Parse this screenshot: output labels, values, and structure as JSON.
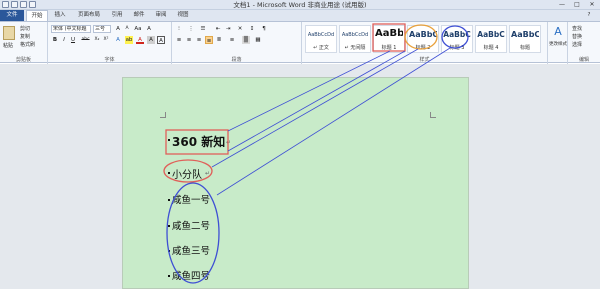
{
  "window": {
    "title": "文档1 - Microsoft Word 非商业用途 (试用版)",
    "controls": [
      "—",
      "□",
      "✕"
    ]
  },
  "tabs": [
    {
      "label": "文件"
    },
    {
      "label": "开始"
    },
    {
      "label": "插入"
    },
    {
      "label": "页面布局"
    },
    {
      "label": "引用"
    },
    {
      "label": "邮件"
    },
    {
      "label": "审阅"
    },
    {
      "label": "视图"
    }
  ],
  "ribbon": {
    "clipboard": {
      "paste": "粘贴",
      "cut": "剪切",
      "copy": "复制",
      "format_painter": "格式刷",
      "group_label": "剪贴板"
    },
    "font": {
      "name": "宋体 (中文标题",
      "size": "三号",
      "grow": "A",
      "shrink": "A",
      "case": "Aa",
      "clear": "A",
      "bold": "B",
      "italic": "I",
      "underline": "U",
      "strike": "abc",
      "subscript": "X₂",
      "superscript": "X²",
      "effects": "A",
      "highlight": "ab",
      "color": "A",
      "char_shade": "A",
      "char_border": "A",
      "group_label": "字体"
    },
    "paragraph": {
      "line_spacing": "≡",
      "group_label": "段落"
    },
    "styles": {
      "group_label": "样式",
      "items": [
        {
          "preview": "AaBbCcDd",
          "name": "↵ 正文"
        },
        {
          "preview": "AaBbCcDd",
          "name": "↵ 无间隔"
        },
        {
          "preview": "AaBb",
          "name": "标题 1"
        },
        {
          "preview": "AaBbC",
          "name": "标题 2"
        },
        {
          "preview": "AaBbC",
          "name": "标题 3"
        },
        {
          "preview": "AaBbC",
          "name": "标题 4"
        },
        {
          "preview": "AaBbC",
          "name": "标题"
        }
      ],
      "change_styles": "更改样式"
    },
    "editing": {
      "find": "查找",
      "replace": "替换",
      "select": "选择",
      "group_label": "编辑"
    }
  },
  "document": {
    "heading1": "360 新知",
    "heading2": "小分队",
    "heading3_items": [
      "咸鱼一号",
      "咸鱼二号",
      "咸鱼三号",
      "咸鱼四号"
    ]
  },
  "annotations": {
    "box_color": "#e0605a",
    "circle_color": "#e9a13b",
    "line_color": "#3e4fd4",
    "circle_color_2": "#3e4fd4"
  }
}
